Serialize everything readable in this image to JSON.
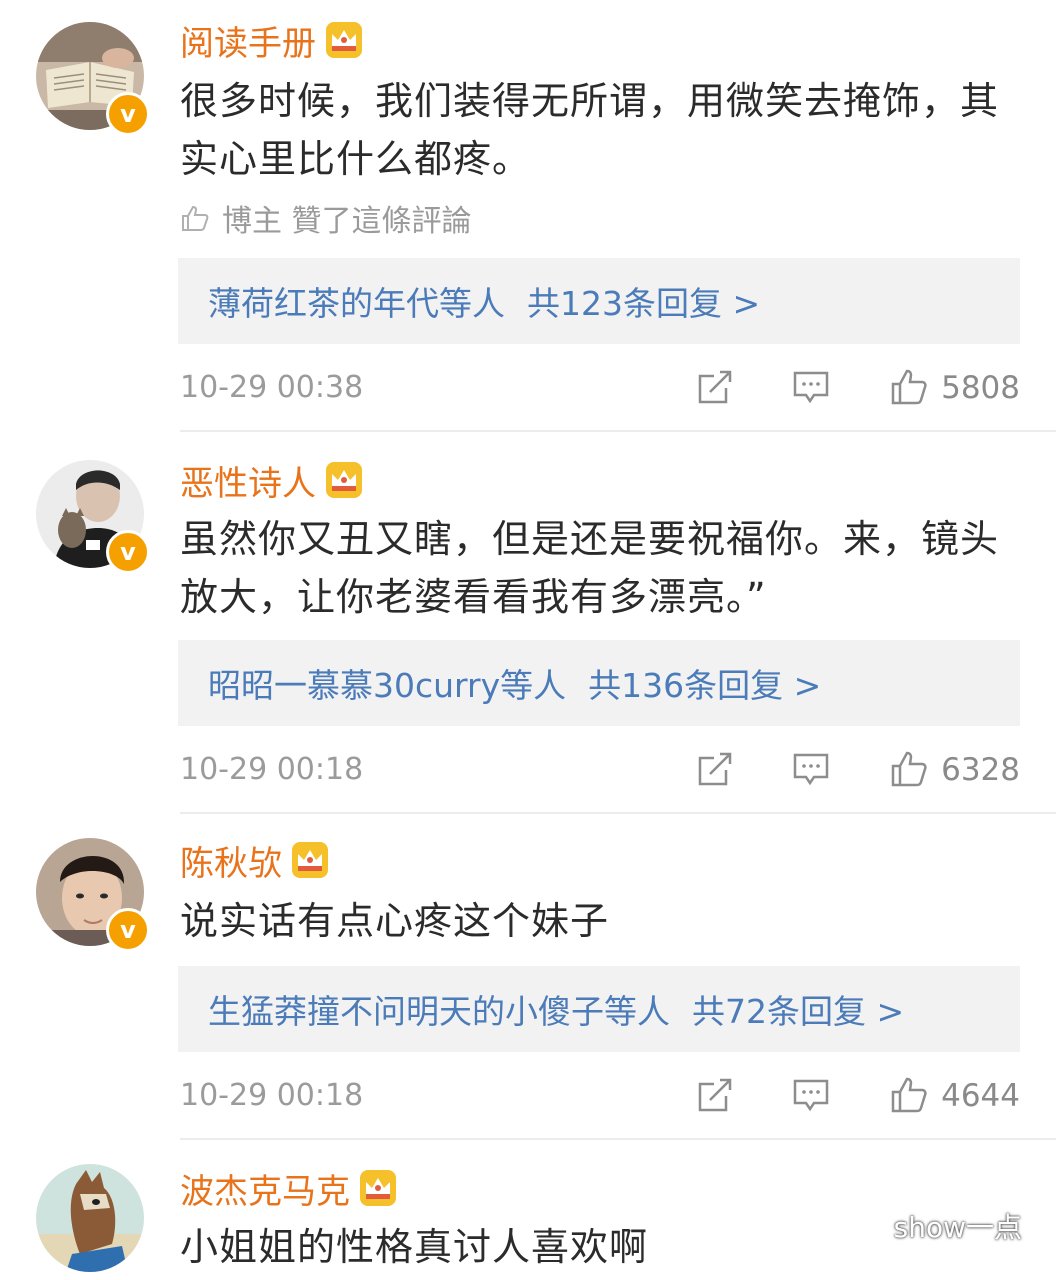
{
  "comments": [
    {
      "username": "阅读手册",
      "text": "很多时候，我们装得无所谓，用微笑去掩饰，其实心里比什么都疼。",
      "liked_by": "博主 贊了這條評論",
      "reply_users": "薄荷红茶的年代等人",
      "reply_count": "共123条回复 >",
      "timestamp": "10-29 00:38",
      "likes": "5808"
    },
    {
      "username": "恶性诗人",
      "text": "虽然你又丑又瞎，但是还是要祝福你。来，镜头放大，让你老婆看看我有多漂亮。”",
      "reply_users": "昭昭一慕慕30curry等人",
      "reply_count": "共136条回复 >",
      "timestamp": "10-29 00:18",
      "likes": "6328"
    },
    {
      "username": "陈秋欤",
      "text": "说实话有点心疼这个妹子",
      "reply_users": "生猛莽撞不问明天的小傻子等人",
      "reply_count": "共72条回复 >",
      "timestamp": "10-29 00:18",
      "likes": "4644"
    },
    {
      "username": "波杰克马克",
      "text": "小姐姐的性格真讨人喜欢啊"
    }
  ],
  "badge": {
    "verified_letter": "v"
  },
  "icons": {
    "crown": "crown-icon",
    "thumb": "thumbs-up-icon",
    "repost": "repost-icon",
    "comment": "comment-icon",
    "verified": "verified-badge-icon"
  },
  "colors": {
    "username": "#e8731b",
    "reply_link": "#4b7bb8",
    "verified": "#f6a000"
  },
  "watermark": {
    "label": "show一点"
  }
}
